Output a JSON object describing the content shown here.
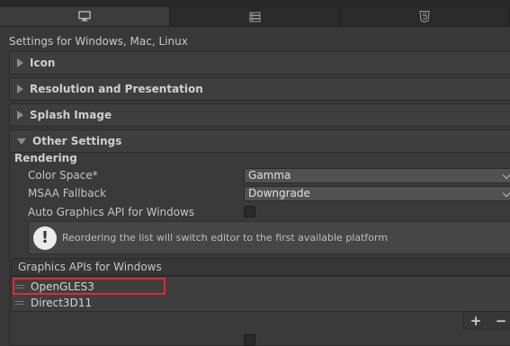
{
  "tabs": [
    {
      "icon": "monitor-icon",
      "active": true
    },
    {
      "icon": "server-icon",
      "active": false
    },
    {
      "icon": "html5-icon",
      "active": false
    }
  ],
  "header": "Settings for Windows, Mac, Linux",
  "sections": [
    {
      "label": "Icon"
    },
    {
      "label": "Resolution and Presentation"
    },
    {
      "label": "Splash Image"
    },
    {
      "label": "Other Settings"
    }
  ],
  "rendering": {
    "title": "Rendering",
    "color_space_label": "Color Space*",
    "color_space_value": "Gamma",
    "msaa_label": "MSAA Fallback",
    "msaa_value": "Downgrade",
    "auto_graphics_label": "Auto Graphics API  for Windows",
    "auto_graphics_checked": false
  },
  "helpbox": {
    "message": "Reordering the list will switch editor to the first available platform"
  },
  "graphics_apis": {
    "title": "Graphics APIs for Windows",
    "items": [
      "OpenGLES3",
      "Direct3D11"
    ],
    "add": "+",
    "remove": "−"
  }
}
